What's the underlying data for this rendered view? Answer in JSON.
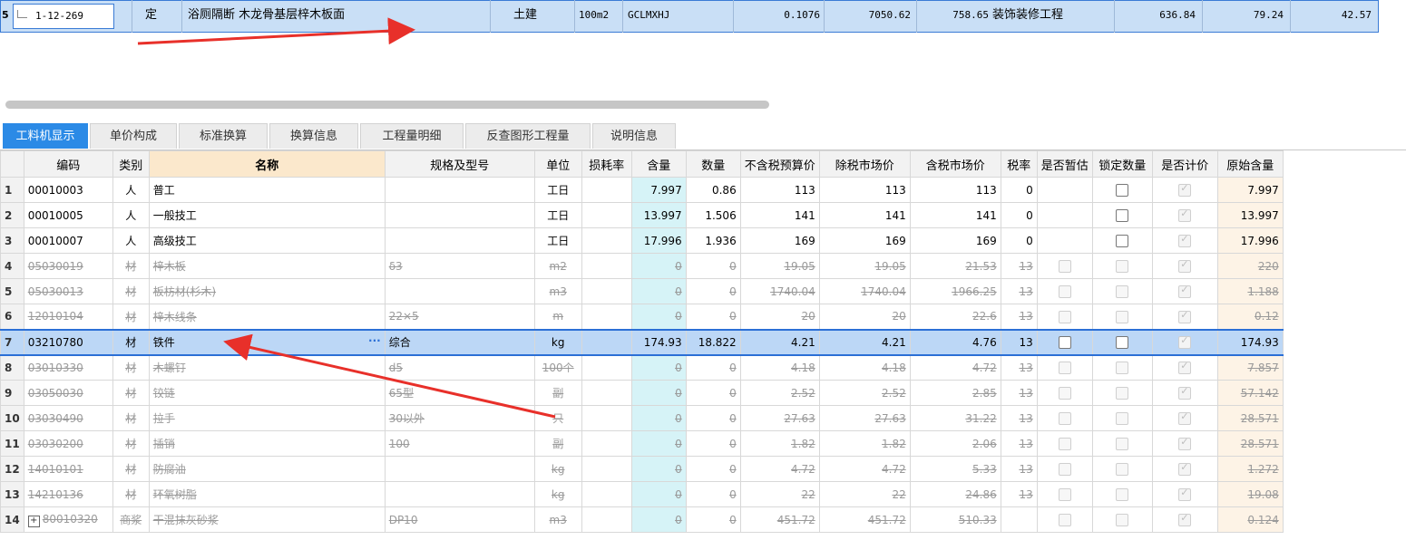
{
  "top_row": {
    "row_index": "5",
    "code": "1-12-269",
    "type": "定",
    "name": "浴厕隔断 木龙骨基层梓木板面",
    "specialty": "土建",
    "unit": "100m2",
    "code2": "GCLMXHJ",
    "quantity": "0.1076",
    "unit_price": "7050.62",
    "total": "758.65",
    "category": "装饰装修工程",
    "v1": "636.84",
    "v2": "79.24",
    "v3": "42.57"
  },
  "tabs": [
    "工料机显示",
    "单价构成",
    "标准换算",
    "换算信息",
    "工程量明细",
    "反查图形工程量",
    "说明信息"
  ],
  "active_tab": "工料机显示",
  "columns": [
    "编码",
    "类别",
    "名称",
    "规格及型号",
    "单位",
    "损耗率",
    "含量",
    "数量",
    "不含税预算价",
    "除税市场价",
    "含税市场价",
    "税率",
    "是否暂估",
    "锁定数量",
    "是否计价",
    "原始含量"
  ],
  "rows": [
    {
      "idx": "1",
      "code": "00010003",
      "cat": "人",
      "name": "普工",
      "spec": "",
      "unit": "工日",
      "loss": "",
      "content": "7.997",
      "qty": "0.86",
      "budget": "113",
      "mkt": "113",
      "mkt_tax": "113",
      "tax": "0",
      "est": "none",
      "lock": "box",
      "priced": "checked",
      "orig": "7.997",
      "struck": false,
      "sel": false
    },
    {
      "idx": "2",
      "code": "00010005",
      "cat": "人",
      "name": "一般技工",
      "spec": "",
      "unit": "工日",
      "loss": "",
      "content": "13.997",
      "qty": "1.506",
      "budget": "141",
      "mkt": "141",
      "mkt_tax": "141",
      "tax": "0",
      "est": "none",
      "lock": "box",
      "priced": "checked",
      "orig": "13.997",
      "struck": false,
      "sel": false
    },
    {
      "idx": "3",
      "code": "00010007",
      "cat": "人",
      "name": "高级技工",
      "spec": "",
      "unit": "工日",
      "loss": "",
      "content": "17.996",
      "qty": "1.936",
      "budget": "169",
      "mkt": "169",
      "mkt_tax": "169",
      "tax": "0",
      "est": "none",
      "lock": "box",
      "priced": "checked",
      "orig": "17.996",
      "struck": false,
      "sel": false
    },
    {
      "idx": "4",
      "code": "05030019",
      "cat": "材",
      "name": "梓木板",
      "spec": "δ3",
      "unit": "m2",
      "loss": "",
      "content": "0",
      "qty": "0",
      "budget": "19.05",
      "mkt": "19.05",
      "mkt_tax": "21.53",
      "tax": "13",
      "est": "dim",
      "lock": "dim",
      "priced": "checked",
      "orig": "220",
      "struck": true,
      "sel": false
    },
    {
      "idx": "5",
      "code": "05030013",
      "cat": "材",
      "name": "板枋材(杉木)",
      "spec": "",
      "unit": "m3",
      "loss": "",
      "content": "0",
      "qty": "0",
      "budget": "1740.04",
      "mkt": "1740.04",
      "mkt_tax": "1966.25",
      "tax": "13",
      "est": "dim",
      "lock": "dim",
      "priced": "checked",
      "orig": "1.188",
      "struck": true,
      "sel": false
    },
    {
      "idx": "6",
      "code": "12010104",
      "cat": "材",
      "name": "梓木线条",
      "spec": "22×5",
      "unit": "m",
      "loss": "",
      "content": "0",
      "qty": "0",
      "budget": "20",
      "mkt": "20",
      "mkt_tax": "22.6",
      "tax": "13",
      "est": "dim",
      "lock": "dim",
      "priced": "checked",
      "orig": "0.12",
      "struck": true,
      "sel": false
    },
    {
      "idx": "7",
      "code": "03210780",
      "cat": "材",
      "name": "铁件",
      "spec": "综合",
      "unit": "kg",
      "loss": "",
      "content": "174.93",
      "qty": "18.822",
      "budget": "4.21",
      "mkt": "4.21",
      "mkt_tax": "4.76",
      "tax": "13",
      "est": "box",
      "lock": "box",
      "priced": "checked",
      "orig": "174.93",
      "struck": false,
      "sel": true
    },
    {
      "idx": "8",
      "code": "03010330",
      "cat": "材",
      "name": "木螺钉",
      "spec": "d5",
      "unit": "100个",
      "loss": "",
      "content": "0",
      "qty": "0",
      "budget": "4.18",
      "mkt": "4.18",
      "mkt_tax": "4.72",
      "tax": "13",
      "est": "dim",
      "lock": "dim",
      "priced": "checked",
      "orig": "7.857",
      "struck": true,
      "sel": false
    },
    {
      "idx": "9",
      "code": "03050030",
      "cat": "材",
      "name": "铰链",
      "spec": "65型",
      "unit": "副",
      "loss": "",
      "content": "0",
      "qty": "0",
      "budget": "2.52",
      "mkt": "2.52",
      "mkt_tax": "2.85",
      "tax": "13",
      "est": "dim",
      "lock": "dim",
      "priced": "checked",
      "orig": "57.142",
      "struck": true,
      "sel": false
    },
    {
      "idx": "10",
      "code": "03030490",
      "cat": "材",
      "name": "拉手",
      "spec": "30以外",
      "unit": "只",
      "loss": "",
      "content": "0",
      "qty": "0",
      "budget": "27.63",
      "mkt": "27.63",
      "mkt_tax": "31.22",
      "tax": "13",
      "est": "dim",
      "lock": "dim",
      "priced": "checked",
      "orig": "28.571",
      "struck": true,
      "sel": false
    },
    {
      "idx": "11",
      "code": "03030200",
      "cat": "材",
      "name": "插销",
      "spec": "100",
      "unit": "副",
      "loss": "",
      "content": "0",
      "qty": "0",
      "budget": "1.82",
      "mkt": "1.82",
      "mkt_tax": "2.06",
      "tax": "13",
      "est": "dim",
      "lock": "dim",
      "priced": "checked",
      "orig": "28.571",
      "struck": true,
      "sel": false
    },
    {
      "idx": "12",
      "code": "14010101",
      "cat": "材",
      "name": "防腐油",
      "spec": "",
      "unit": "kg",
      "loss": "",
      "content": "0",
      "qty": "0",
      "budget": "4.72",
      "mkt": "4.72",
      "mkt_tax": "5.33",
      "tax": "13",
      "est": "dim",
      "lock": "dim",
      "priced": "checked",
      "orig": "1.272",
      "struck": true,
      "sel": false
    },
    {
      "idx": "13",
      "code": "14210136",
      "cat": "材",
      "name": "环氧树脂",
      "spec": "",
      "unit": "kg",
      "loss": "",
      "content": "0",
      "qty": "0",
      "budget": "22",
      "mkt": "22",
      "mkt_tax": "24.86",
      "tax": "13",
      "est": "dim",
      "lock": "dim",
      "priced": "checked",
      "orig": "19.08",
      "struck": true,
      "sel": false
    },
    {
      "idx": "14",
      "code": "80010320",
      "cat": "商浆",
      "name": "干混抹灰砂浆",
      "spec": "DP10",
      "unit": "m3",
      "loss": "",
      "content": "0",
      "qty": "0",
      "budget": "451.72",
      "mkt": "451.72",
      "mkt_tax": "510.33",
      "tax": "",
      "est": "dim",
      "lock": "dim",
      "priced": "checked",
      "orig": "0.124",
      "struck": true,
      "sel": false,
      "expandable": true
    }
  ],
  "colors": {
    "accent": "#2b8ae6",
    "selection": "#bcd7f6",
    "arrow": "#e8302a"
  }
}
